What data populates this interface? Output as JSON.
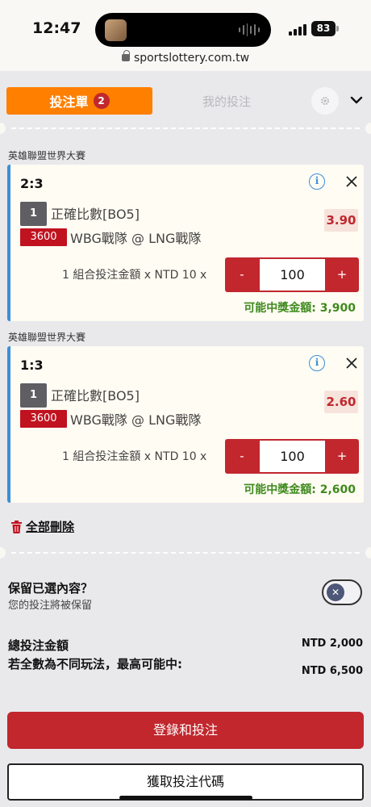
{
  "status_bar": {
    "time": "12:47",
    "battery": "83"
  },
  "browser": {
    "url": "sportslottery.com.tw"
  },
  "tabs": {
    "active_label": "投注單",
    "active_badge": "2",
    "inactive_label": "我的投注"
  },
  "bets": [
    {
      "league": "英雄聯盟世界大賽",
      "score": "2:3",
      "leg_number": "1",
      "market": "正確比數[BO5]",
      "odds": "3.90",
      "match_id": "3600",
      "match_name": "WBG戰隊 @ LNG戰隊",
      "stake_label": "1 組合投注金額 x NTD 10 x",
      "minus": "-",
      "stake_value": "100",
      "plus": "+",
      "prize": "可能中獎金額: 3,900"
    },
    {
      "league": "英雄聯盟世界大賽",
      "score": "1:3",
      "leg_number": "1",
      "market": "正確比數[BO5]",
      "odds": "2.60",
      "match_id": "3600",
      "match_name": "WBG戰隊 @ LNG戰隊",
      "stake_label": "1 組合投注金額 x NTD 10 x",
      "minus": "-",
      "stake_value": "100",
      "plus": "+",
      "prize": "可能中獎金額: 2,600"
    }
  ],
  "delete_all": "全部刪除",
  "keep": {
    "title": "保留已選內容？",
    "subtitle": "您的投注將被保留",
    "toggle_on": false
  },
  "summary": {
    "total_label": "總投注金額",
    "total_value": "NTD 2,000",
    "max_label": "若全數為不同玩法，最高可能中:",
    "max_value": "NTD 6,500"
  },
  "actions": {
    "login_label": "登錄和投注",
    "code_label": "獲取投注代碼"
  },
  "colors": {
    "accent_orange": "#ff7f00",
    "brand_red": "#c1272d",
    "prize_green": "#3f8a1f",
    "info_blue": "#3a8fd9"
  }
}
